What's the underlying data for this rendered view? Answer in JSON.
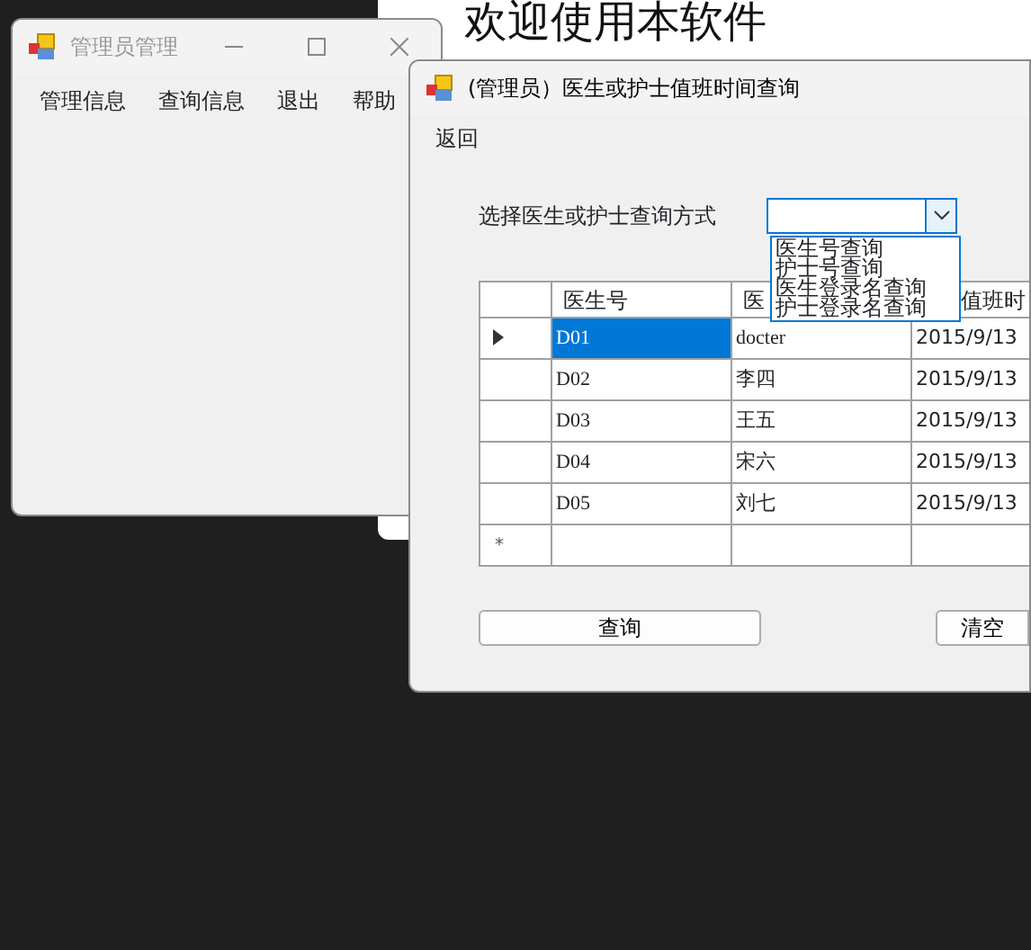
{
  "background_window": {
    "heading": "欢迎使用本软件"
  },
  "main_window": {
    "title": "管理员管理",
    "active": false,
    "menu": [
      "管理信息",
      "查询信息",
      "退出",
      "帮助"
    ]
  },
  "dialog": {
    "title": "(管理员）医生或护士值班时间查询",
    "active": true,
    "menu": [
      "返回"
    ],
    "query_label": "选择医生或护士查询方式",
    "combo": {
      "expanded": true,
      "options": [
        "医生号查询",
        "护士号查询",
        "医生登录名查询",
        "护士登录名查询"
      ]
    },
    "grid": {
      "columns": [
        "医生号",
        "医",
        "值班时"
      ],
      "rows": [
        {
          "cells": [
            "D01",
            "docter",
            "2015/9/13"
          ],
          "selected": true
        },
        {
          "cells": [
            "D02",
            "李四",
            "2015/9/13"
          ],
          "selected": false
        },
        {
          "cells": [
            "D03",
            "王五",
            "2015/9/13"
          ],
          "selected": false
        },
        {
          "cells": [
            "D04",
            "宋六",
            "2015/9/13"
          ],
          "selected": false
        },
        {
          "cells": [
            "D05",
            "刘七",
            "2015/9/13"
          ],
          "selected": false
        }
      ],
      "new_row_marker": "*"
    },
    "buttons": [
      "查询",
      "清空"
    ]
  }
}
